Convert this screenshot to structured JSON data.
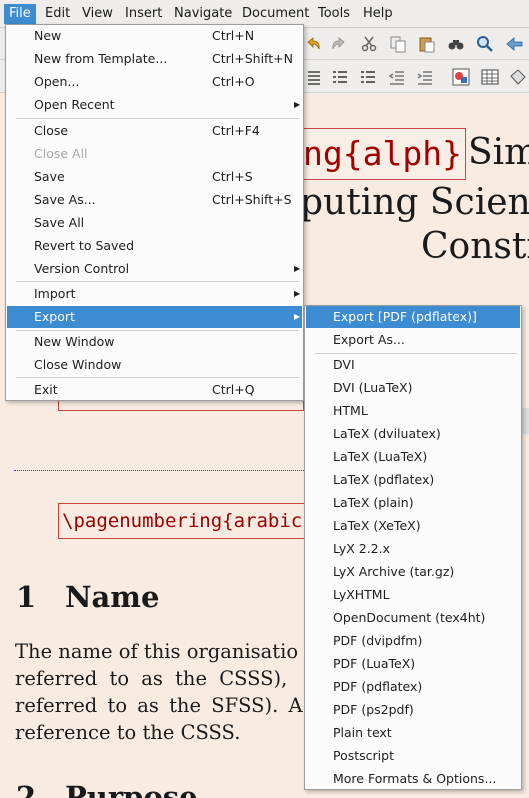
{
  "menubar": {
    "items": [
      {
        "label": "File"
      },
      {
        "label": "Edit"
      },
      {
        "label": "View"
      },
      {
        "label": "Insert"
      },
      {
        "label": "Navigate"
      },
      {
        "label": "Document"
      },
      {
        "label": "Tools"
      },
      {
        "label": "Help"
      }
    ]
  },
  "file_menu": {
    "items": [
      {
        "label": "New",
        "shortcut": "Ctrl+N"
      },
      {
        "label": "New from Template...",
        "shortcut": "Ctrl+Shift+N"
      },
      {
        "label": "Open...",
        "shortcut": "Ctrl+O"
      },
      {
        "label": "Open Recent",
        "shortcut": ""
      },
      {
        "label": "Close",
        "shortcut": "Ctrl+F4"
      },
      {
        "label": "Close All",
        "shortcut": ""
      },
      {
        "label": "Save",
        "shortcut": "Ctrl+S"
      },
      {
        "label": "Save As...",
        "shortcut": "Ctrl+Shift+S"
      },
      {
        "label": "Save All",
        "shortcut": ""
      },
      {
        "label": "Revert to Saved",
        "shortcut": ""
      },
      {
        "label": "Version Control",
        "shortcut": ""
      },
      {
        "label": "Import",
        "shortcut": ""
      },
      {
        "label": "Export",
        "shortcut": ""
      },
      {
        "label": "New Window",
        "shortcut": ""
      },
      {
        "label": "Close Window",
        "shortcut": ""
      },
      {
        "label": "Exit",
        "shortcut": "Ctrl+Q"
      }
    ]
  },
  "export_menu": {
    "items": [
      {
        "label": "Export [PDF (pdflatex)]"
      },
      {
        "label": "Export As..."
      },
      {
        "label": "DVI"
      },
      {
        "label": "DVI (LuaTeX)"
      },
      {
        "label": "HTML"
      },
      {
        "label": "LaTeX (dviluatex)"
      },
      {
        "label": "LaTeX (LuaTeX)"
      },
      {
        "label": "LaTeX (pdflatex)"
      },
      {
        "label": "LaTeX (plain)"
      },
      {
        "label": "LaTeX (XeTeX)"
      },
      {
        "label": "LyX 2.2.x"
      },
      {
        "label": "LyX Archive (tar.gz)"
      },
      {
        "label": "LyXHTML"
      },
      {
        "label": "OpenDocument (tex4ht)"
      },
      {
        "label": "PDF (dvipdfm)"
      },
      {
        "label": "PDF (LuaTeX)"
      },
      {
        "label": "PDF (pdflatex)"
      },
      {
        "label": "PDF (ps2pdf)"
      },
      {
        "label": "Plain text"
      },
      {
        "label": "Postscript"
      },
      {
        "label": "More Formats & Options..."
      }
    ]
  },
  "document": {
    "latex1": "ng{alph}",
    "title_part1": "Sim",
    "title_line2": "puting Scienc",
    "title_line3": "Consti",
    "latex2": "\\pagenumbering{arabic",
    "section1_number": "1",
    "section1_title": "Name",
    "para_line1": "The name of this organisatio",
    "para_line2": "referred to as the CSSS),",
    "para_line3": "referred to as the SFSS). A",
    "para_line4": "reference to the CSSS.",
    "section2_number": "2",
    "section2_title": "Purpose"
  },
  "colors": {
    "accent": "#3d8bd0",
    "latex_red": "#a00000",
    "document_bg": "#f8ece2"
  }
}
